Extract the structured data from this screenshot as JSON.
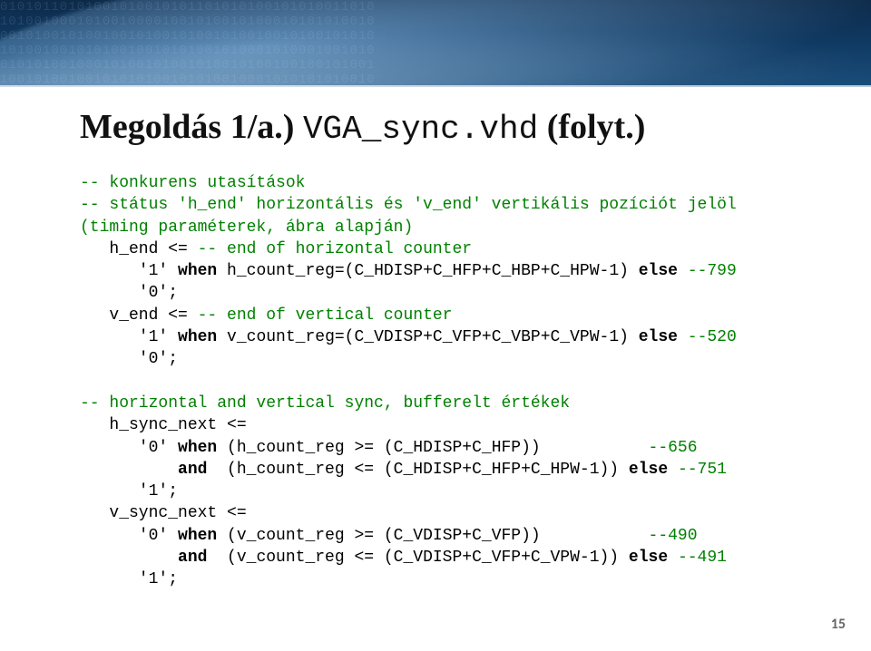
{
  "title": {
    "prefix": "Megoldás 1/a.) ",
    "code": "VGA_sync.vhd",
    "suffix": " (folyt.)"
  },
  "code": {
    "l1": "-- konkurens utasítások",
    "l2": "-- státus 'h_end' horizontális és 'v_end' vertikális pozíciót jelöl",
    "l3": "(timing paraméterek, ábra alapján)",
    "l4a": "   h_end <= ",
    "l4b": "-- end of horizontal counter",
    "l5a": "      '1' ",
    "l5kw1": "when",
    "l5b": " h_count_reg=(C_HDISP+C_HFP+C_HBP+C_HPW-1) ",
    "l5kw2": "else",
    "l5c": " ",
    "l5d": "--799",
    "l6": "      '0';",
    "l7a": "   v_end <= ",
    "l7b": "-- end of vertical counter",
    "l8a": "      '1' ",
    "l8kw1": "when",
    "l8b": " v_count_reg=(C_VDISP+C_VFP+C_VBP+C_VPW-1) ",
    "l8kw2": "else",
    "l8c": " ",
    "l8d": "--520",
    "l9": "      '0';",
    "blank1": "",
    "l10": "-- horizontal and vertical sync, bufferelt értékek",
    "l11": "   h_sync_next <=",
    "l12a": "      '0' ",
    "l12kw1": "when",
    "l12b": " (h_count_reg >= (C_HDISP+C_HFP))           ",
    "l12c": "--656",
    "l13a": "          ",
    "l13kw1": "and",
    "l13b": "  (h_count_reg <= (C_HDISP+C_HFP+C_HPW-1)) ",
    "l13kw2": "else",
    "l13c": " ",
    "l13d": "--751",
    "l14": "      '1';",
    "l15": "   v_sync_next <=",
    "l16a": "      '0' ",
    "l16kw1": "when",
    "l16b": " (v_count_reg >= (C_VDISP+C_VFP))           ",
    "l16c": "--490",
    "l17a": "          ",
    "l17kw1": "and",
    "l17b": "  (v_count_reg <= (C_VDISP+C_VFP+C_VPW-1)) ",
    "l17kw2": "else",
    "l17c": " ",
    "l17d": "--491",
    "l18": "      '1';"
  },
  "page_number": "15",
  "banner_digits": "01010110101001010010101101010100101010011010\n10100100010100100001001010010100010101010010\n00101001010010010100101001010010010100101010\n10100100101010010010101001010001010001001010\n01010100100010100101001010010100100100101001\n10010100100101010100101010010001010101010010"
}
